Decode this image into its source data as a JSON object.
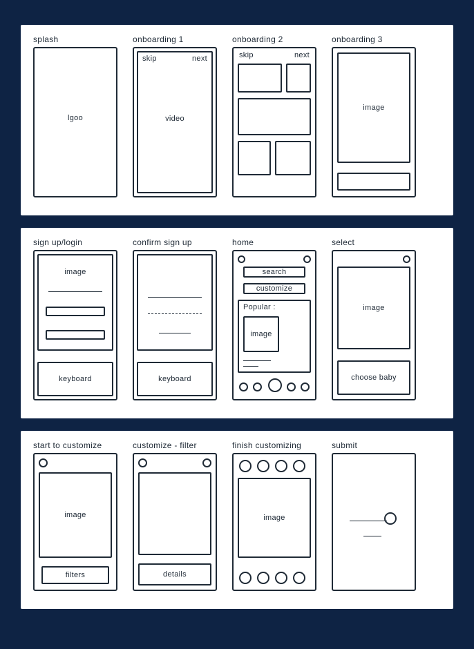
{
  "screens": {
    "splash": {
      "title": "splash",
      "content": "lgoo"
    },
    "onb1": {
      "title": "onboarding 1",
      "skip": "skip",
      "next": "next",
      "content": "video"
    },
    "onb2": {
      "title": "onboarding 2",
      "skip": "skip",
      "next": "next"
    },
    "onb3": {
      "title": "onboarding 3",
      "content": "image"
    },
    "signup": {
      "title": "sign up/login",
      "image": "image",
      "keyboard": "keyboard"
    },
    "confirm": {
      "title": "confirm sign up",
      "keyboard": "keyboard"
    },
    "home": {
      "title": "home",
      "search": "search",
      "customize": "customize",
      "popular": "Popular :",
      "image": "image"
    },
    "select": {
      "title": "select",
      "image": "image",
      "choose": "choose baby"
    },
    "start": {
      "title": "start to customize",
      "image": "image",
      "filters": "filters"
    },
    "filter": {
      "title": "customize - filter",
      "details": "details"
    },
    "finish": {
      "title": "finish customizing",
      "image": "image"
    },
    "submit": {
      "title": "submit"
    }
  }
}
